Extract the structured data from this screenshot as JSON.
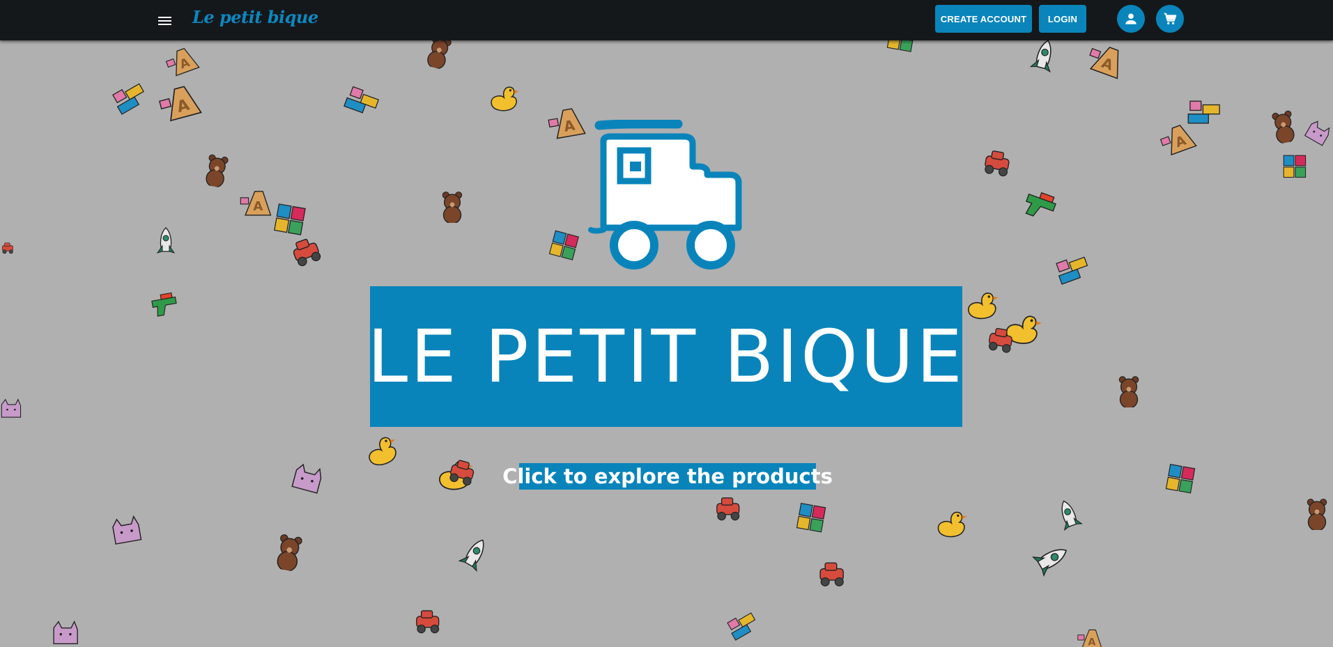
{
  "header": {
    "brand": "Le petit bique",
    "create_account_label": "CREATE ACCOUNT",
    "login_label": "LOGIN",
    "icons": [
      "menu-icon",
      "user-icon",
      "cart-icon"
    ]
  },
  "hero": {
    "title": "LE PETIT BIQUE",
    "cta": "Click to explore the products"
  },
  "colors": {
    "background": "#b0b0b0",
    "topbar": "#15181b",
    "accent": "#0984bb",
    "brand_text": "#0d87c0"
  },
  "background_toys": [
    "teddy-bear-icon",
    "rocket-icon",
    "duck-icon",
    "puzzle-icon",
    "toy-car-icon",
    "letter-block-icon",
    "building-blocks-icon",
    "toy-gun-icon",
    "plush-cat-icon"
  ]
}
